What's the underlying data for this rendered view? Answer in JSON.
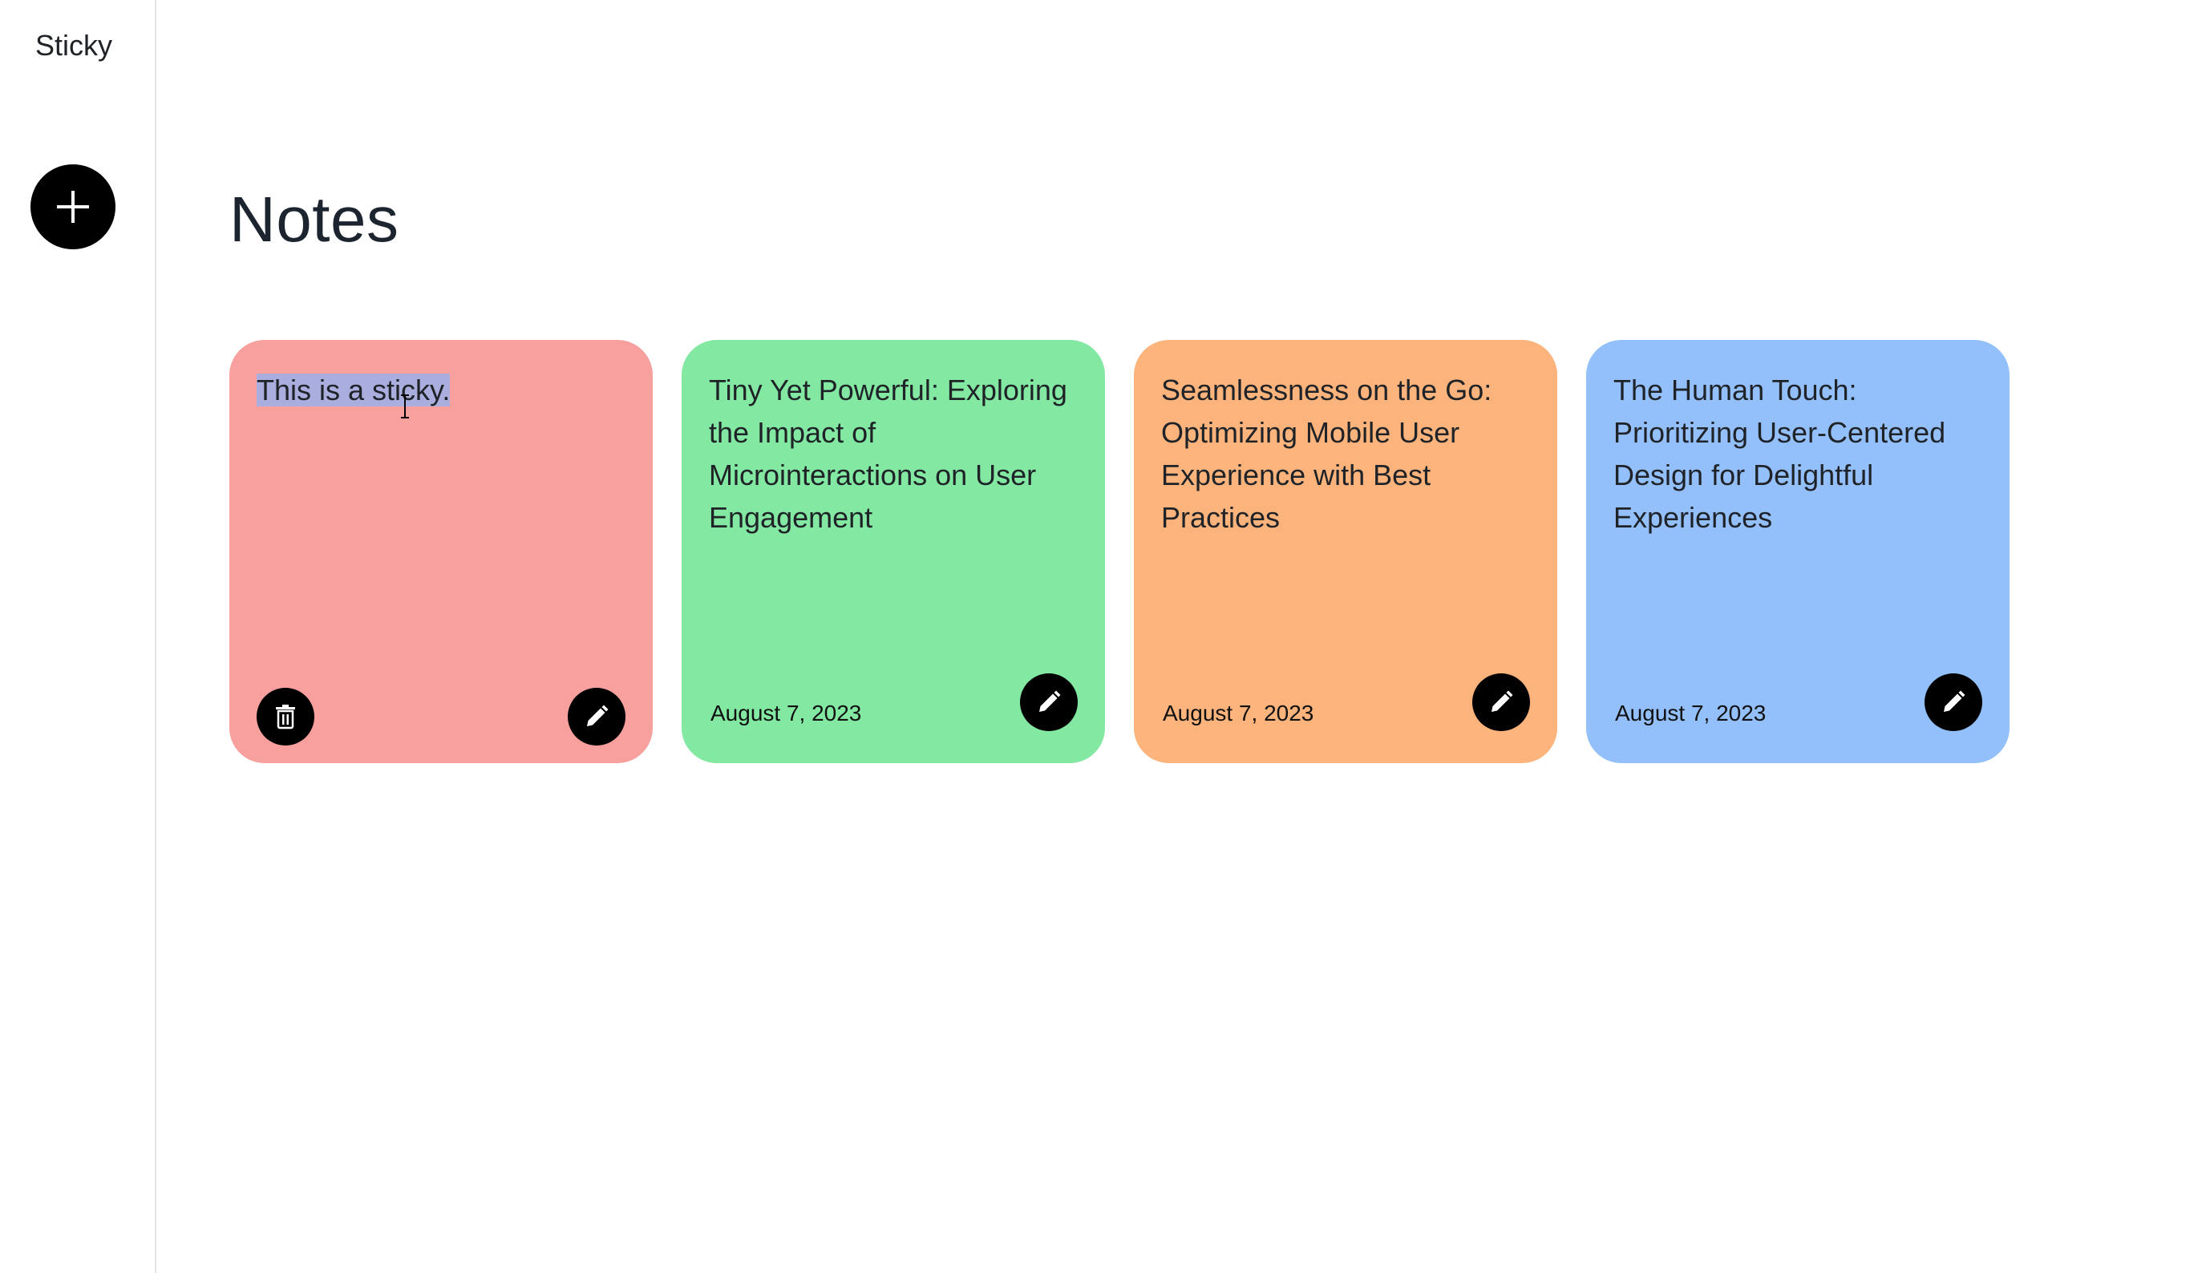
{
  "sidebar": {
    "brand": "Sticky",
    "add_button_icon": "plus-icon"
  },
  "main": {
    "title": "Notes"
  },
  "notes": [
    {
      "text": "This is a sticky.",
      "date": "",
      "color": "#f7a09e",
      "selected": true,
      "actions": [
        "trash-icon",
        "pencil-icon"
      ]
    },
    {
      "text": "Tiny Yet Powerful: Exploring the Impact of Microinteractions on User Engagement",
      "date": "August 7, 2023",
      "color": "#82e8a2",
      "actions": [
        "pencil-icon"
      ]
    },
    {
      "text": "Seamlessness on the Go: Optimizing Mobile User Experience with Best Practices",
      "date": "August 7, 2023",
      "color": "#fcb47c",
      "actions": [
        "pencil-icon"
      ]
    },
    {
      "text": "The Human Touch: Prioritizing User-Centered Design for Delightful Experiences",
      "date": "August 7, 2023",
      "color": "#93bffa",
      "actions": [
        "pencil-icon"
      ]
    }
  ]
}
